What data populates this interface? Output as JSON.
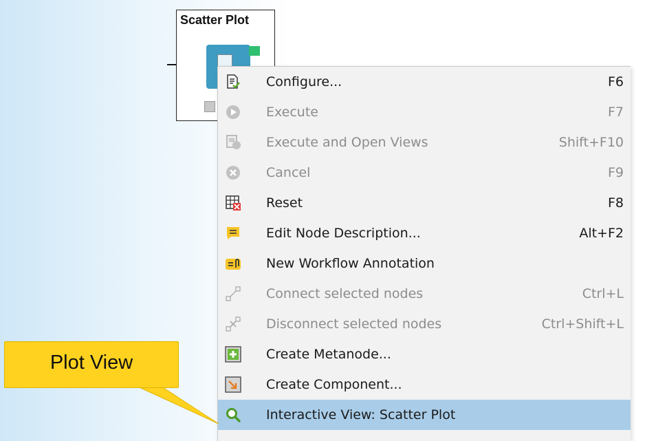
{
  "node": {
    "title": "Scatter Plot"
  },
  "menu": {
    "items": [
      {
        "label": "Configure...",
        "shortcut": "F6",
        "icon": "configure-icon",
        "enabled": true
      },
      {
        "label": "Execute",
        "shortcut": "F7",
        "icon": "execute-icon",
        "enabled": false
      },
      {
        "label": "Execute and Open Views",
        "shortcut": "Shift+F10",
        "icon": "execute-open-views-icon",
        "enabled": false
      },
      {
        "label": "Cancel",
        "shortcut": "F9",
        "icon": "cancel-icon",
        "enabled": false
      },
      {
        "label": "Reset",
        "shortcut": "F8",
        "icon": "reset-icon",
        "enabled": true
      },
      {
        "label": "Edit Node Description...",
        "shortcut": "Alt+F2",
        "icon": "edit-description-icon",
        "enabled": true
      },
      {
        "label": "New Workflow Annotation",
        "shortcut": "",
        "icon": "annotation-icon",
        "enabled": true
      },
      {
        "label": "Connect selected nodes",
        "shortcut": "Ctrl+L",
        "icon": "connect-nodes-icon",
        "enabled": false
      },
      {
        "label": "Disconnect selected nodes",
        "shortcut": "Ctrl+Shift+L",
        "icon": "disconnect-nodes-icon",
        "enabled": false
      },
      {
        "label": "Create Metanode...",
        "shortcut": "",
        "icon": "metanode-icon",
        "enabled": true
      },
      {
        "label": "Create Component...",
        "shortcut": "",
        "icon": "component-icon",
        "enabled": true
      },
      {
        "label": "Interactive View: Scatter Plot",
        "shortcut": "",
        "icon": "interactive-view-icon",
        "enabled": true,
        "highlighted": true
      }
    ]
  },
  "callout": {
    "text": "Plot View"
  },
  "colors": {
    "callout_fill": "#ffd21f",
    "highlight": "#a9cde9",
    "node_body": "#3e9bc1",
    "node_port": "#2fbf71"
  }
}
